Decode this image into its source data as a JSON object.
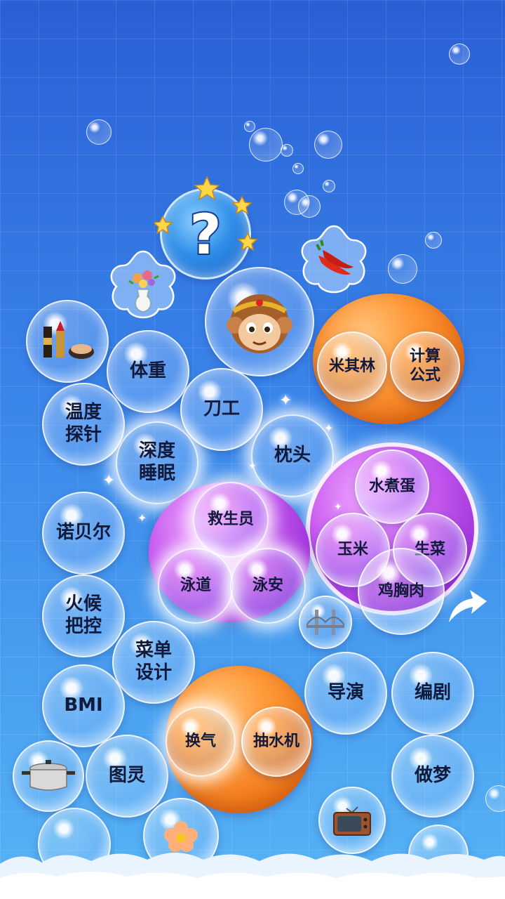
{
  "bubbles": {
    "weight": "体重",
    "thermometer": "温度\n探针",
    "knife_skill": "刀工",
    "deep_sleep": "深度\n睡眠",
    "pillow": "枕头",
    "michelin": "米其林",
    "formula": "计算\n公式",
    "nobel": "诺贝尔",
    "lifeguard": "救生员",
    "swim_lane": "泳道",
    "swim_safe": "泳安",
    "boiled_egg": "水煮蛋",
    "corn": "玉米",
    "lettuce": "生菜",
    "chicken_breast": "鸡胸肉",
    "heat_control": "火候\n把控",
    "menu_design": "菜单\n设计",
    "bmi": "BMI",
    "ventilate": "换气",
    "pump": "抽水机",
    "director": "导演",
    "screenwriter": "编剧",
    "turing": "图灵",
    "dreaming": "做梦"
  },
  "icons": {
    "mystery": "question-mark-icon",
    "monkey": "monkey-king-icon",
    "cosmetics": "cosmetics-icon",
    "vase": "flower-vase-icon",
    "pepper": "chili-pepper-icon",
    "bridge": "bridge-icon",
    "pot": "cooking-pot-icon",
    "tv": "television-icon",
    "flower": "flower-icon",
    "arrow": "curved-up-arrow-icon"
  },
  "colors": {
    "orange": "#f07a1c",
    "purple": "#b044e6",
    "background_top": "#2a5fd6",
    "background_bottom": "#56b4f5"
  }
}
